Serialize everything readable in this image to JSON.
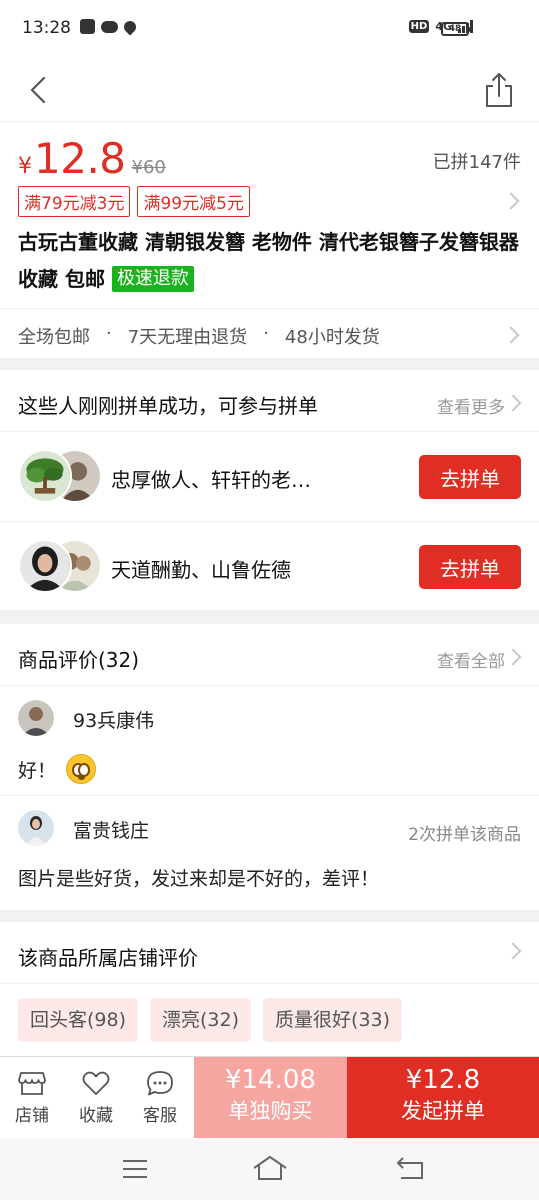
{
  "status_bar": {
    "time": "13:28",
    "network": "4G",
    "hd": "HD",
    "battery": "48"
  },
  "product": {
    "currency": "¥",
    "price": "12.8",
    "original_price": "¥60",
    "sold": "已拼147件",
    "coupons": [
      "满79元减3元",
      "满99元减5元"
    ],
    "title": "古玩古董收藏 清朝银发簪 老物件 清代老银簪子发簪银器收藏 包邮",
    "refund_tag": "极速退款",
    "services": [
      "全场包邮",
      "·",
      "7天无理由退货",
      "·",
      "48小时发货"
    ]
  },
  "group_buy": {
    "title": "这些人刚刚拼单成功，可参与拼单",
    "see_more": "查看更多",
    "groups": [
      {
        "names": "忠厚做人、轩轩的老…",
        "button": "去拼单"
      },
      {
        "names": "天道酬勤、山鲁佐德",
        "button": "去拼单"
      }
    ]
  },
  "reviews": {
    "title": "商品评价(32)",
    "see_all": "查看全部",
    "items": [
      {
        "user": "93兵康伟",
        "extra": "",
        "content": "好！"
      },
      {
        "user": "富贵钱庄",
        "extra": "2次拼单该商品",
        "content": "图片是些好货，发过来却是不好的，差评！"
      }
    ]
  },
  "shop_reviews": {
    "title": "该商品所属店铺评价",
    "tags": [
      "回头客(98)",
      "漂亮(32)",
      "质量很好(33)"
    ]
  },
  "bottom_bar": {
    "shop": "店铺",
    "favorite": "收藏",
    "service": "客服",
    "buy_alone_price": "¥14.08",
    "buy_alone_label": "单独购买",
    "buy_group_price": "¥12.8",
    "buy_group_label": "发起拼单"
  },
  "colors": {
    "accent": "#e02e24",
    "accent_light": "#f7a5a1",
    "green_tag": "#19b31d"
  }
}
